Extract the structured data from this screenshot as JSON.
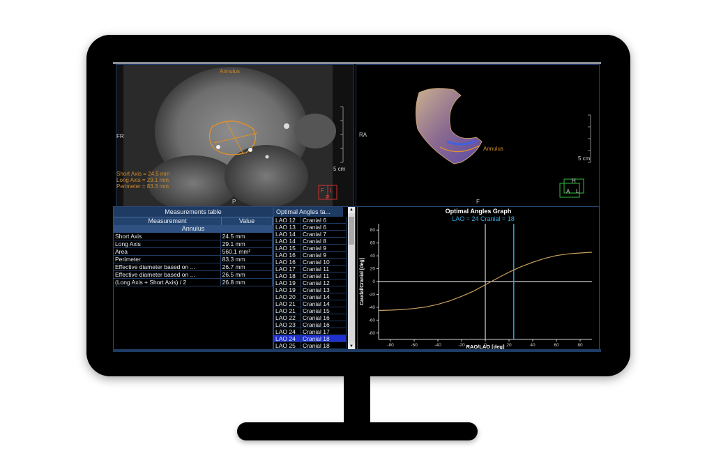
{
  "viewport_axial": {
    "top_label": "Annulus",
    "left_label": "FR",
    "bottom_label": "P",
    "scale_label": "5 cm",
    "short_axis": "Short Axis = 24.5 mm",
    "long_axis": "Long Axis = 29.1 mm",
    "perimeter": "Perimeter = 83.3 mm",
    "orientation": {
      "f": "F",
      "l": "L",
      "p": "P"
    }
  },
  "viewport_3d": {
    "left_label": "RA",
    "bottom_label": "F",
    "annulus_label": "Annulus",
    "scale_label": "5 cm",
    "orientation": {
      "h": "H",
      "a": "A",
      "l": "L"
    }
  },
  "measurements_table": {
    "title": "Measurements table",
    "col_measurement": "Measurement",
    "col_value": "Value",
    "section": "Annulus",
    "rows": [
      {
        "name": "Short Axis",
        "value": "24.5 mm"
      },
      {
        "name": "Long Axis",
        "value": "29.1 mm"
      },
      {
        "name": "Area",
        "value": "560.1 mm²"
      },
      {
        "name": "Perimeter",
        "value": "83.3 mm"
      },
      {
        "name": "Effective diameter based on ...",
        "value": "26.7 mm"
      },
      {
        "name": "Effective diameter based on ...",
        "value": "26.5 mm"
      },
      {
        "name": "(Long Axis + Short Axis) / 2",
        "value": "26.8 mm"
      }
    ]
  },
  "optimal_angles_table": {
    "title": "Optimal Angles ta...",
    "rows": [
      {
        "lao": "LAO 12",
        "cranial": "Cranial 6"
      },
      {
        "lao": "LAO 13",
        "cranial": "Cranial 6"
      },
      {
        "lao": "LAO 14",
        "cranial": "Cranial 7"
      },
      {
        "lao": "LAO 14",
        "cranial": "Cranial 8"
      },
      {
        "lao": "LAO 15",
        "cranial": "Cranial 9"
      },
      {
        "lao": "LAO 16",
        "cranial": "Cranial 9"
      },
      {
        "lao": "LAO 16",
        "cranial": "Cranial 10"
      },
      {
        "lao": "LAO 17",
        "cranial": "Cranial 11"
      },
      {
        "lao": "LAO 18",
        "cranial": "Cranial 11"
      },
      {
        "lao": "LAO 19",
        "cranial": "Cranial 12"
      },
      {
        "lao": "LAO 19",
        "cranial": "Cranial 13"
      },
      {
        "lao": "LAO 20",
        "cranial": "Cranial 14"
      },
      {
        "lao": "LAO 21",
        "cranial": "Cranial 14"
      },
      {
        "lao": "LAO 21",
        "cranial": "Cranial 15"
      },
      {
        "lao": "LAO 22",
        "cranial": "Cranial 16"
      },
      {
        "lao": "LAO 23",
        "cranial": "Cranial 16"
      },
      {
        "lao": "LAO 24",
        "cranial": "Cranial 17"
      },
      {
        "lao": "LAO 24",
        "cranial": "Cranial 18"
      },
      {
        "lao": "LAO 25",
        "cranial": "Cranial 18"
      }
    ],
    "selected_index": 17
  },
  "chart_data": {
    "type": "line",
    "title": "Optimal Angles Graph",
    "annotation": "LAO = 24 Cranial = 18",
    "xlabel": "RAO/LAO [deg]",
    "ylabel": "Caudal/Cranial [deg]",
    "xlim": [
      -90,
      90
    ],
    "ylim": [
      -90,
      90
    ],
    "xticks": [
      -80,
      -60,
      -40,
      -20,
      0,
      20,
      40,
      60,
      80
    ],
    "yticks": [
      -80,
      -60,
      -40,
      -20,
      0,
      20,
      40,
      60,
      80
    ],
    "marker_x": 24,
    "series": [
      {
        "x": [
          -90,
          -80,
          -70,
          -60,
          -50,
          -40,
          -30,
          -20,
          -10,
          0,
          10,
          20,
          24,
          30,
          40,
          50,
          60,
          70,
          80,
          90
        ],
        "y": [
          -45,
          -44.5,
          -43.5,
          -42,
          -39.5,
          -35.5,
          -30,
          -23,
          -15,
          -5,
          5,
          14.5,
          18,
          23,
          30,
          36,
          40.5,
          43,
          44.5,
          45.5
        ]
      }
    ],
    "colors": {
      "curve": "#c8a060",
      "marker": "#3aa8e0",
      "axes": "#d0d0d0"
    }
  }
}
